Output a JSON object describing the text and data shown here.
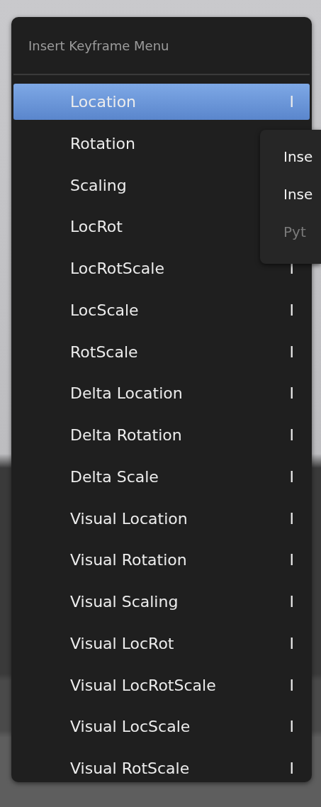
{
  "menu": {
    "title": "Insert Keyframe Menu",
    "items": [
      {
        "label": "Location",
        "shortcut": "I",
        "selected": true
      },
      {
        "label": "Rotation",
        "selected": false
      },
      {
        "label": "Scaling",
        "selected": false
      },
      {
        "label": "LocRot",
        "selected": false
      },
      {
        "label": "LocRotScale",
        "shortcut": "I",
        "selected": false
      },
      {
        "label": "LocScale",
        "shortcut": "I",
        "selected": false
      },
      {
        "label": "RotScale",
        "shortcut": "I",
        "selected": false
      },
      {
        "label": "Delta Location",
        "shortcut": "I",
        "selected": false
      },
      {
        "label": "Delta Rotation",
        "shortcut": "I",
        "selected": false
      },
      {
        "label": "Delta Scale",
        "shortcut": "I",
        "selected": false
      },
      {
        "label": "Visual Location",
        "shortcut": "I",
        "selected": false
      },
      {
        "label": "Visual Rotation",
        "shortcut": "I",
        "selected": false
      },
      {
        "label": "Visual Scaling",
        "shortcut": "I",
        "selected": false
      },
      {
        "label": "Visual LocRot",
        "shortcut": "I",
        "selected": false
      },
      {
        "label": "Visual LocRotScale",
        "shortcut": "I",
        "selected": false
      },
      {
        "label": "Visual LocScale",
        "shortcut": "I",
        "selected": false
      },
      {
        "label": "Visual RotScale",
        "shortcut": "I",
        "selected": false
      }
    ]
  },
  "tooltip": {
    "lines": [
      {
        "text": "Inse",
        "kind": "normal"
      },
      {
        "text": "Inse",
        "kind": "normal"
      },
      {
        "text": "Pyt",
        "kind": "python"
      }
    ]
  }
}
